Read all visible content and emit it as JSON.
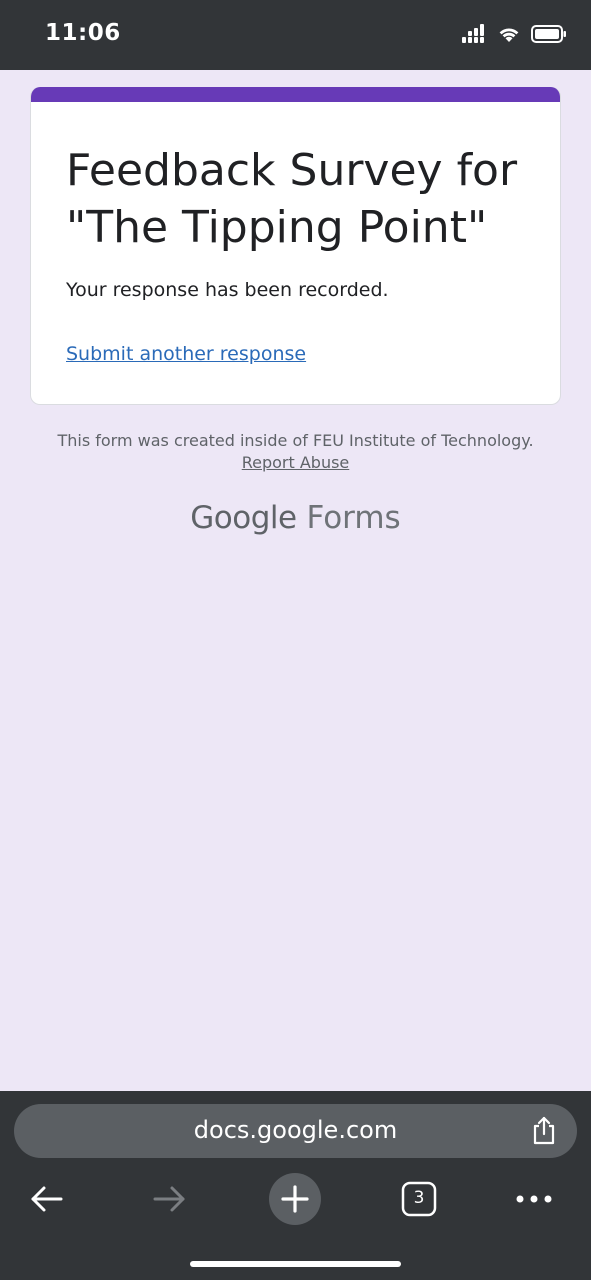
{
  "status_bar": {
    "time": "11:06",
    "icons": [
      "signal-icon",
      "wifi-icon",
      "battery-icon"
    ]
  },
  "form": {
    "accent_color": "#673AB7",
    "title": "Feedback Survey for \"The Tipping Point\"",
    "confirmation_message": "Your response has been recorded.",
    "submit_another_label": "Submit another response"
  },
  "footer": {
    "created_inside": "This form was created inside of FEU Institute of Technology.",
    "report_abuse_label": "Report Abuse",
    "brand_google": "Google",
    "brand_forms": "Forms"
  },
  "browser": {
    "url": "docs.google.com",
    "tab_count": "3",
    "nav_icons": [
      "back-arrow-icon",
      "forward-arrow-icon",
      "new-tab-plus-icon",
      "tabs-icon",
      "more-icon",
      "share-icon"
    ]
  }
}
